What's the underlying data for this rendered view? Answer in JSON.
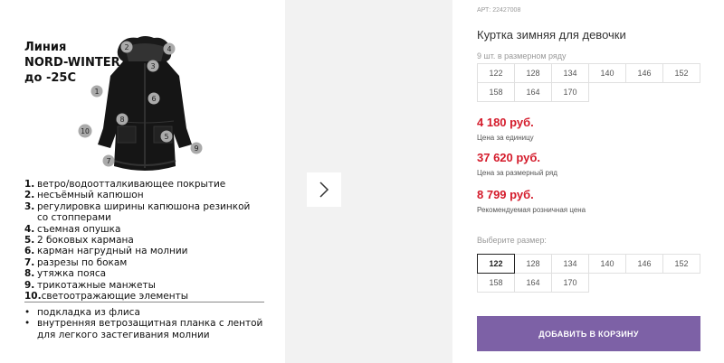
{
  "product_image": {
    "line_title": [
      "Линия",
      "NORD-WINTER",
      "до -25С"
    ],
    "callout_numbers": [
      "2",
      "4",
      "3",
      "1",
      "6",
      "8",
      "10",
      "5",
      "9",
      "7"
    ],
    "features": [
      {
        "num": "1.",
        "text": "ветро/водоотталкивающее покрытие"
      },
      {
        "num": "2.",
        "text": "несъёмный капюшон"
      },
      {
        "num": "3.",
        "text": "регулировка ширины капюшона  резинкой"
      },
      {
        "num": "",
        "text": "со стопперами"
      },
      {
        "num": "4.",
        "text": "съемная опушка"
      },
      {
        "num": "5.",
        "text": "2 боковых кармана"
      },
      {
        "num": "6.",
        "text": "карман нагрудный на молнии"
      },
      {
        "num": "7.",
        "text": "разрезы по бокам"
      },
      {
        "num": "8.",
        "text": "утяжка пояса"
      },
      {
        "num": "9.",
        "text": "трикотажные манжеты"
      },
      {
        "num": "10.",
        "text": "светоотражающие элементы"
      }
    ],
    "extras": [
      {
        "text": "подкладка из флиса"
      },
      {
        "text": "внутренняя ветрозащитная планка с лентой"
      },
      {
        "text": "для легкого застегивания молнии",
        "continuation": true
      }
    ]
  },
  "gallery": {
    "next_icon": "chevron-right"
  },
  "details": {
    "sku": "АРТ: 22427008",
    "title": "Куртка зимняя для девочки",
    "ryad_label": "9 шт. в размерном ряду",
    "ryad_sizes": [
      "122",
      "128",
      "134",
      "140",
      "146",
      "152",
      "158",
      "164",
      "170"
    ],
    "price_unit": "4 180 руб.",
    "price_unit_label": "Цена за единицу",
    "price_ryad": "37 620 руб.",
    "price_ryad_label": "Цена за размерный ряд",
    "price_retail": "8 799 руб.",
    "price_retail_label": "Рекомендуемая розничная цена",
    "choose_label": "Выберите размер:",
    "choose_sizes": [
      "122",
      "128",
      "134",
      "140",
      "146",
      "152",
      "158",
      "164",
      "170"
    ],
    "selected_size": "122",
    "cart_button": "ДОБАВИТЬ В КОРЗИНУ",
    "colors": {
      "price": "#d41b2b",
      "button": "#7d61a6"
    }
  }
}
